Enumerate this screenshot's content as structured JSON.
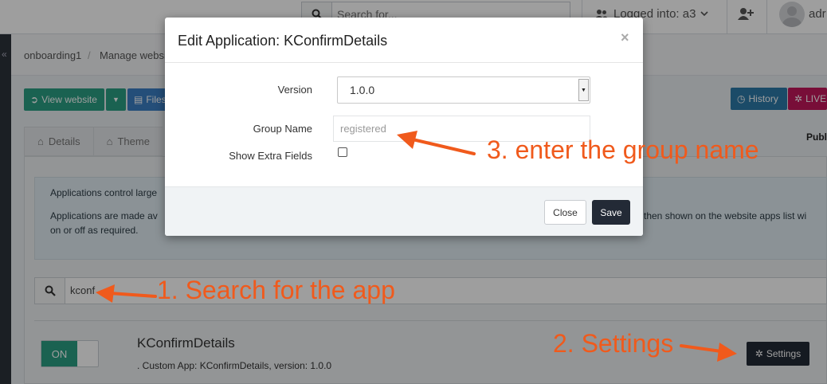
{
  "topbar": {
    "search_placeholder": "Search for...",
    "logged_into": "Logged into: a3",
    "user_name": "adr"
  },
  "breadcrumb": {
    "items": [
      "onboarding1",
      "/",
      "Manage websi"
    ]
  },
  "toolbar": {
    "view_website": "View website",
    "files": "Files",
    "history": "History",
    "live": "LIVE"
  },
  "tabs": [
    {
      "label": "Details",
      "icon": "home-icon"
    },
    {
      "label": "Theme",
      "icon": "home-icon"
    }
  ],
  "publish_label": "Publi",
  "info": {
    "line1": "Applications control large",
    "line2a": "Applications are made av",
    "line2b": "re then shown on the website apps list wi",
    "line3": "on or off as required."
  },
  "app_search": {
    "value": "kconf"
  },
  "app": {
    "toggle_label": "ON",
    "title": "KConfirmDetails",
    "description": ". Custom App: KConfirmDetails, version: 1.0.0",
    "settings_label": "Settings"
  },
  "modal": {
    "title": "Edit Application: KConfirmDetails",
    "close_glyph": "×",
    "version_label": "Version",
    "version_value": "1.0.0",
    "group_name_label": "Group Name",
    "group_name_placeholder": "registered",
    "show_extra_label": "Show Extra Fields",
    "show_extra_checked": false,
    "close_button": "Close",
    "save_button": "Save"
  },
  "annotations": {
    "step1": "1. Search for the app",
    "step2": "2. Settings",
    "step3": "3. enter the group name",
    "color": "#f05a1c"
  },
  "colors": {
    "green": "#2b9e83",
    "dark": "#232a36",
    "history_blue": "#2d7aa8",
    "live_pink": "#c2185b",
    "files_blue": "#3b7fc4"
  }
}
